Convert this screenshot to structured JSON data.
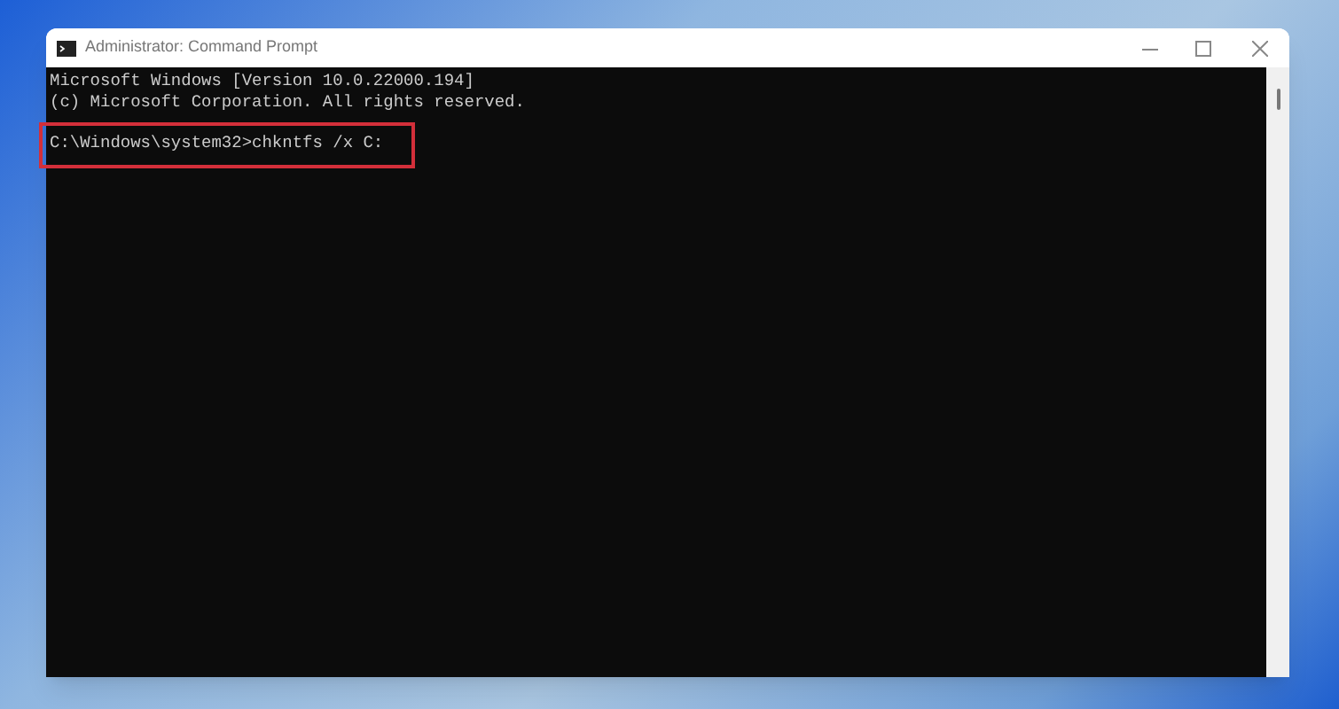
{
  "window": {
    "title": "Administrator: Command Prompt"
  },
  "console": {
    "lines": [
      {
        "text": "Microsoft Windows [Version 10.0.22000.194]",
        "highlighted": false
      },
      {
        "text": "(c) Microsoft Corporation. All rights reserved.",
        "highlighted": false
      },
      {
        "highlighted": false
      },
      {
        "text": "C:\\Windows\\system32>chkntfs /x C:",
        "highlighted": true
      }
    ]
  }
}
